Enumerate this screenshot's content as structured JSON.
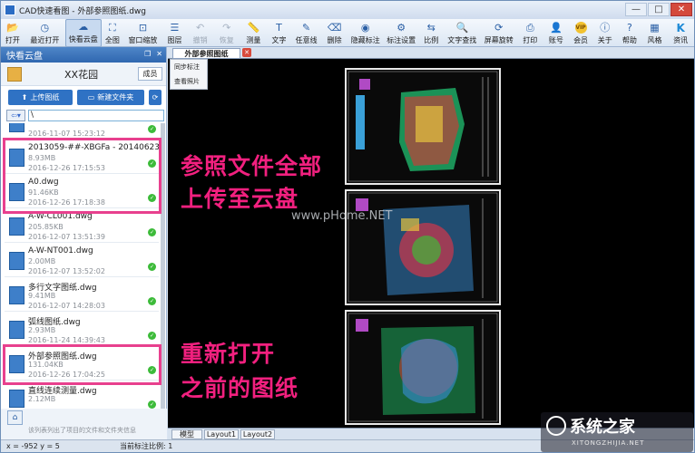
{
  "window": {
    "title": "CAD快速看图 - 外部参照图纸.dwg",
    "controls": [
      "—",
      "□",
      "✕"
    ]
  },
  "toolbar": [
    {
      "label": "打开",
      "icon": "open-folder-icon",
      "glyph": "📂"
    },
    {
      "label": "最近打开",
      "icon": "recent-icon",
      "glyph": "◷"
    },
    {
      "label": "快看云盘",
      "icon": "cloud-icon",
      "glyph": "☁",
      "active": true
    },
    {
      "label": "全图",
      "icon": "fit-all-icon",
      "glyph": "⛶"
    },
    {
      "label": "窗口缩放",
      "icon": "window-zoom-icon",
      "glyph": "⊡"
    },
    {
      "label": "图层",
      "icon": "layers-icon",
      "glyph": "☰"
    },
    {
      "label": "撤销",
      "icon": "undo-icon",
      "glyph": "↶",
      "disabled": true
    },
    {
      "label": "恢复",
      "icon": "redo-icon",
      "glyph": "↷",
      "disabled": true
    },
    {
      "label": "测量",
      "icon": "measure-icon",
      "glyph": "📏"
    },
    {
      "label": "文字",
      "icon": "text-icon",
      "glyph": "T"
    },
    {
      "label": "任意线",
      "icon": "freeline-icon",
      "glyph": "✎"
    },
    {
      "label": "删除",
      "icon": "eraser-icon",
      "glyph": "⌫"
    },
    {
      "label": "隐藏标注",
      "icon": "hide-annotation-icon",
      "glyph": "◉"
    },
    {
      "label": "标注设置",
      "icon": "annotation-settings-icon",
      "glyph": "⚙"
    },
    {
      "label": "比例",
      "icon": "scale-icon",
      "glyph": "⇆"
    },
    {
      "label": "文字查找",
      "icon": "text-search-icon",
      "glyph": "🔍"
    },
    {
      "label": "屏幕旋转",
      "icon": "rotate-screen-icon",
      "glyph": "⟳"
    },
    {
      "label": "打印",
      "icon": "print-icon",
      "glyph": "⎙"
    },
    {
      "label": "账号",
      "icon": "account-icon",
      "glyph": "👤"
    },
    {
      "label": "会员",
      "icon": "vip-icon",
      "glyph": "VIP"
    },
    {
      "label": "关于",
      "icon": "about-icon",
      "glyph": "ⓘ"
    },
    {
      "label": "帮助",
      "icon": "help-icon",
      "glyph": "?"
    },
    {
      "label": "风格",
      "icon": "style-icon",
      "glyph": "▦"
    },
    {
      "label": "资讯",
      "icon": "news-icon",
      "glyph": "K"
    }
  ],
  "panel": {
    "title": "快看云盘",
    "username": "XX花园",
    "member_label": "成员",
    "upload_label": "上传图纸",
    "newfolder_label": "新建文件夹",
    "path": "\\",
    "footer": "该列表列出了项目的文件和文件夹信息"
  },
  "files": [
    {
      "name": "",
      "size": "",
      "date": "2016-11-07 15:23:12",
      "partial": true
    },
    {
      "name": "2013059-##-XBGFa - 20140623.dwg",
      "size": "8.93MB",
      "date": "2016-12-26 17:15:53"
    },
    {
      "name": "A0.dwg",
      "size": "91.46KB",
      "date": "2016-12-26 17:18:38"
    },
    {
      "name": "A-W-CL001.dwg",
      "size": "205.85KB",
      "date": "2016-12-07 13:51:39"
    },
    {
      "name": "A-W-NT001.dwg",
      "size": "2.00MB",
      "date": "2016-12-07 13:52:02"
    },
    {
      "name": "多行文字图纸.dwg",
      "size": "9.41MB",
      "date": "2016-12-07 14:28:03"
    },
    {
      "name": "弧线图纸.dwg",
      "size": "2.93MB",
      "date": "2016-11-24 14:39:43"
    },
    {
      "name": "外部参照图纸.dwg",
      "size": "131.04KB",
      "date": "2016-12-26 17:04:25"
    },
    {
      "name": "直线连续测量.dwg",
      "size": "2.12MB",
      "date": ""
    }
  ],
  "doc": {
    "tab_label": "外部参照图纸",
    "popup_items": [
      "同步标注",
      "查看照片"
    ],
    "layout_tabs": [
      "模型",
      "Layout1",
      "Layout2"
    ],
    "overlay1": [
      "参照文件全部",
      "上传至云盘"
    ],
    "overlay2": [
      "重新打开",
      "之前的图纸"
    ],
    "watermark": "www.pHome.NET"
  },
  "status": {
    "coord": "x = -952  y = 5",
    "scale": "当前标注比例: 1"
  },
  "brand": {
    "cn": "系统之家",
    "en": "XITONGZHIJIA.NET"
  },
  "colors": {
    "accent": "#2f72c4",
    "highlight": "#e8408e",
    "ok": "#3dbb3a"
  }
}
